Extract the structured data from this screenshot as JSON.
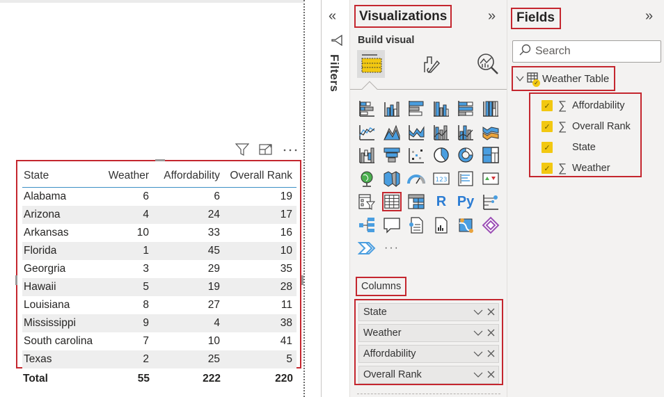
{
  "report_canvas": {
    "visual_header": {
      "filter_icon": "filter-icon",
      "focus_icon": "focus-mode-icon",
      "more_icon": "more-options-icon"
    },
    "table": {
      "columns": [
        "State",
        "Weather",
        "Affordability",
        "Overall Rank"
      ],
      "rows": [
        {
          "state": "Alabama",
          "weather": "6",
          "affordability": "6",
          "overall_rank": "19"
        },
        {
          "state": "Arizona",
          "weather": "4",
          "affordability": "24",
          "overall_rank": "17"
        },
        {
          "state": "Arkansas",
          "weather": "10",
          "affordability": "33",
          "overall_rank": "16"
        },
        {
          "state": "Florida",
          "weather": "1",
          "affordability": "45",
          "overall_rank": "10"
        },
        {
          "state": "Georgria",
          "weather": "3",
          "affordability": "29",
          "overall_rank": "35"
        },
        {
          "state": "Hawaii",
          "weather": "5",
          "affordability": "19",
          "overall_rank": "28"
        },
        {
          "state": "Louisiana",
          "weather": "8",
          "affordability": "27",
          "overall_rank": "11"
        },
        {
          "state": "Mississippi",
          "weather": "9",
          "affordability": "4",
          "overall_rank": "38"
        },
        {
          "state": "South carolina",
          "weather": "7",
          "affordability": "10",
          "overall_rank": "41"
        },
        {
          "state": "Texas",
          "weather": "2",
          "affordability": "25",
          "overall_rank": "5"
        }
      ],
      "total": {
        "label": "Total",
        "weather": "55",
        "affordability": "222",
        "overall_rank": "220"
      }
    }
  },
  "filters_pane": {
    "collapse_glyph": "«",
    "label": "Filters"
  },
  "visualizations_pane": {
    "title": "Visualizations",
    "expand_glyph": "»",
    "build_visual_label": "Build visual",
    "build_tabs": [
      "build-visual",
      "format-visual",
      "analytics"
    ],
    "icons": [
      "stacked-bar-chart",
      "stacked-column-chart",
      "clustered-bar-chart",
      "clustered-column-chart",
      "100-stacked-bar-chart",
      "100-stacked-column-chart",
      "line-chart",
      "area-chart",
      "stacked-area-chart",
      "line-and-stacked-column-chart",
      "line-and-clustered-column-chart",
      "ribbon-chart",
      "waterfall-chart",
      "funnel-chart",
      "scatter-chart",
      "pie-chart",
      "donut-chart",
      "treemap",
      "map",
      "filled-map",
      "gauge",
      "card",
      "multi-row-card",
      "kpi",
      "slicer",
      "table",
      "matrix",
      "r-script-visual",
      "python-visual",
      "key-influencers",
      "decomposition-tree",
      "qna",
      "smart-narrative",
      "paginated-report",
      "arcgis-map",
      "power-apps",
      "power-automate",
      "more-visuals"
    ],
    "icon_text": {
      "r": "R",
      "py": "Py",
      "more": "···",
      "card": "123"
    },
    "selected_icon": "table",
    "columns_label": "Columns",
    "column_wells": [
      "State",
      "Weather",
      "Affordability",
      "Overall Rank"
    ]
  },
  "fields_pane": {
    "title": "Fields",
    "expand_glyph": "»",
    "search_placeholder": "Search",
    "table_name": "Weather Table",
    "fields": [
      {
        "name": "Affordability",
        "checked": true,
        "sigma": true
      },
      {
        "name": "Overall Rank",
        "checked": true,
        "sigma": true
      },
      {
        "name": "State",
        "checked": true,
        "sigma": false
      },
      {
        "name": "Weather",
        "checked": true,
        "sigma": true
      }
    ]
  },
  "colors": {
    "highlight_red": "#c4262e",
    "pbi_yellow": "#f2c811",
    "pbi_blue": "#2b7cd3",
    "pane_bg": "#f3f2f1",
    "header_underline": "#3b8fc5"
  }
}
